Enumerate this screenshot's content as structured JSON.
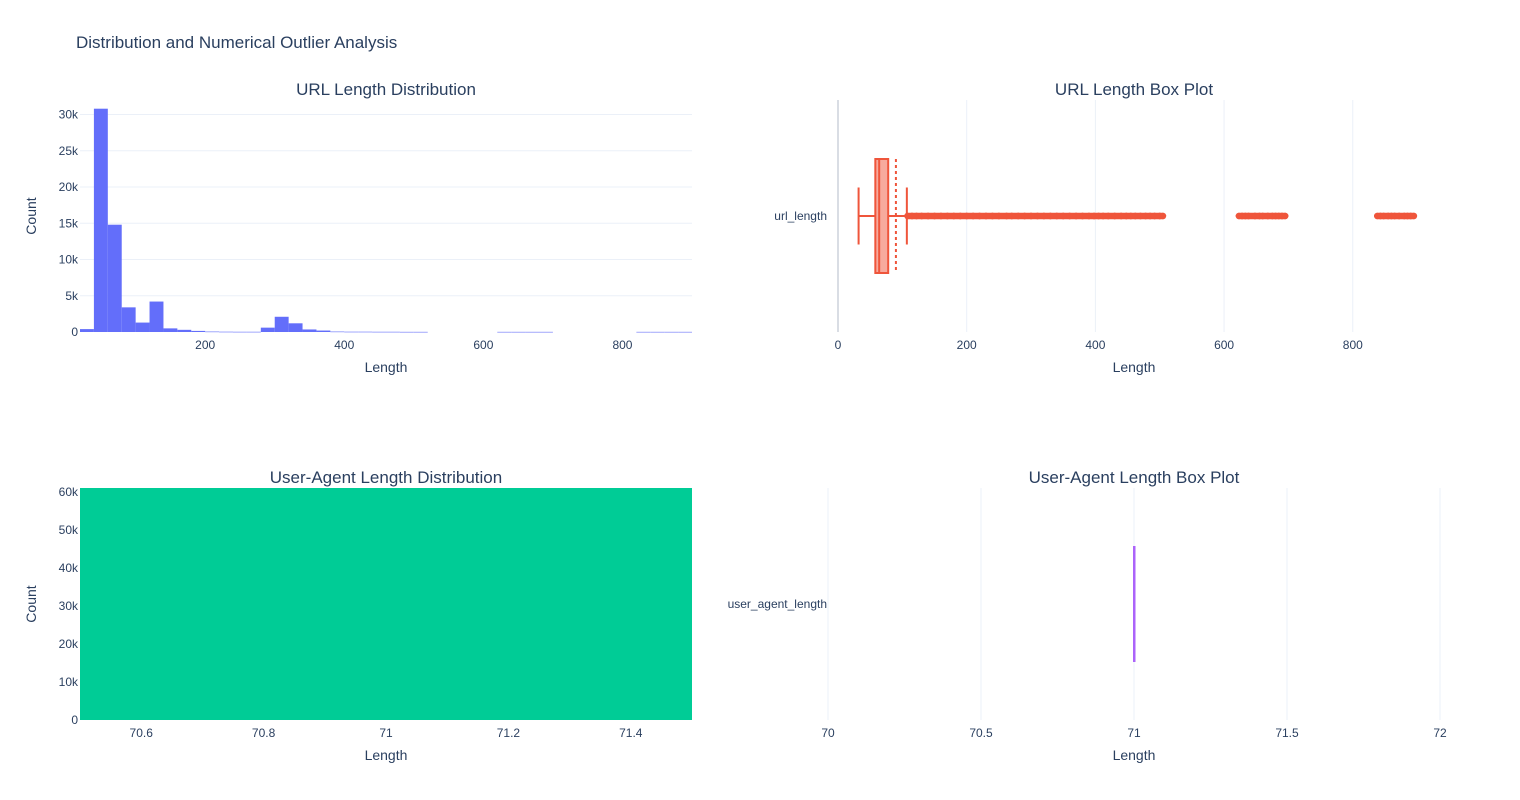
{
  "title": "Distribution and Numerical Outlier Analysis",
  "colors": {
    "url_hist": "#636efa",
    "url_box": "#ef553b",
    "ua_hist": "#00cc96",
    "ua_box": "#ab63fa",
    "grid": "#ebf0f8",
    "text": "#2a3f5f"
  },
  "chart_data": [
    {
      "type": "histogram",
      "title": "URL Length Distribution",
      "xlabel": "Length",
      "ylabel": "Count",
      "xlim": [
        20,
        900
      ],
      "ylim": [
        0,
        32000
      ],
      "x_ticks": [
        200,
        400,
        600,
        800
      ],
      "x_tick_labels": [
        "200",
        "400",
        "600",
        "800"
      ],
      "y_ticks": [
        0,
        5000,
        10000,
        15000,
        20000,
        25000,
        30000
      ],
      "y_tick_labels": [
        "0",
        "5k",
        "10k",
        "15k",
        "20k",
        "25k",
        "30k"
      ],
      "bin_width": 20,
      "bins": [
        {
          "x0": 20,
          "count": 400
        },
        {
          "x0": 40,
          "count": 30800
        },
        {
          "x0": 60,
          "count": 14800
        },
        {
          "x0": 80,
          "count": 3400
        },
        {
          "x0": 100,
          "count": 1300
        },
        {
          "x0": 120,
          "count": 4200
        },
        {
          "x0": 140,
          "count": 500
        },
        {
          "x0": 160,
          "count": 300
        },
        {
          "x0": 180,
          "count": 150
        },
        {
          "x0": 200,
          "count": 60
        },
        {
          "x0": 220,
          "count": 40
        },
        {
          "x0": 240,
          "count": 30
        },
        {
          "x0": 260,
          "count": 30
        },
        {
          "x0": 280,
          "count": 600
        },
        {
          "x0": 300,
          "count": 2100
        },
        {
          "x0": 320,
          "count": 1200
        },
        {
          "x0": 340,
          "count": 350
        },
        {
          "x0": 360,
          "count": 200
        },
        {
          "x0": 380,
          "count": 60
        },
        {
          "x0": 400,
          "count": 40
        },
        {
          "x0": 420,
          "count": 40
        },
        {
          "x0": 440,
          "count": 30
        },
        {
          "x0": 460,
          "count": 30
        },
        {
          "x0": 480,
          "count": 20
        },
        {
          "x0": 500,
          "count": 20
        },
        {
          "x0": 620,
          "count": 20
        },
        {
          "x0": 640,
          "count": 20
        },
        {
          "x0": 660,
          "count": 20
        },
        {
          "x0": 680,
          "count": 20
        },
        {
          "x0": 820,
          "count": 20
        },
        {
          "x0": 840,
          "count": 20
        },
        {
          "x0": 860,
          "count": 20
        },
        {
          "x0": 880,
          "count": 20
        }
      ]
    },
    {
      "type": "box",
      "title": "URL Length Box Plot",
      "xlabel": "Length",
      "category": "url_length",
      "xlim": [
        0,
        920
      ],
      "x_ticks": [
        0,
        200,
        400,
        600,
        800
      ],
      "x_tick_labels": [
        "0",
        "200",
        "400",
        "600",
        "800"
      ],
      "lower_fence": 32,
      "q1": 58,
      "median": 64,
      "q3": 78,
      "upper_fence": 107,
      "mean": 90,
      "outliers": [
        108,
        115,
        122,
        130,
        140,
        150,
        160,
        170,
        180,
        190,
        200,
        210,
        220,
        230,
        240,
        250,
        262,
        270,
        280,
        290,
        300,
        310,
        320,
        330,
        340,
        350,
        360,
        370,
        380,
        390,
        398,
        405,
        412,
        420,
        430,
        440,
        448,
        455,
        462,
        470,
        478,
        485,
        492,
        500,
        505,
        623,
        628,
        633,
        638,
        648,
        655,
        660,
        668,
        675,
        680,
        685,
        690,
        695,
        838,
        843,
        848,
        855,
        860,
        865,
        872,
        880,
        885,
        890,
        895
      ]
    },
    {
      "type": "histogram",
      "title": "User-Agent Length Distribution",
      "xlabel": "Length",
      "ylabel": "Count",
      "xlim": [
        70.5,
        71.5
      ],
      "ylim": [
        0,
        61000
      ],
      "x_ticks": [
        70.6,
        70.8,
        71,
        71.2,
        71.4
      ],
      "x_tick_labels": [
        "70.6",
        "70.8",
        "71",
        "71.2",
        "71.4"
      ],
      "y_ticks": [
        0,
        10000,
        20000,
        30000,
        40000,
        50000,
        60000
      ],
      "y_tick_labels": [
        "0",
        "10k",
        "20k",
        "30k",
        "40k",
        "50k",
        "60k"
      ],
      "bin_width": 1,
      "bins": [
        {
          "x0": 70.5,
          "count": 61000
        }
      ]
    },
    {
      "type": "box",
      "title": "User-Agent Length Box Plot",
      "xlabel": "Length",
      "category": "user_agent_length",
      "xlim": [
        70,
        72
      ],
      "x_ticks": [
        70,
        70.5,
        71,
        71.5,
        72
      ],
      "x_tick_labels": [
        "70",
        "70.5",
        "71",
        "71.5",
        "72"
      ],
      "lower_fence": 71,
      "q1": 71,
      "median": 71,
      "q3": 71,
      "upper_fence": 71,
      "mean": 71,
      "outliers": []
    }
  ]
}
